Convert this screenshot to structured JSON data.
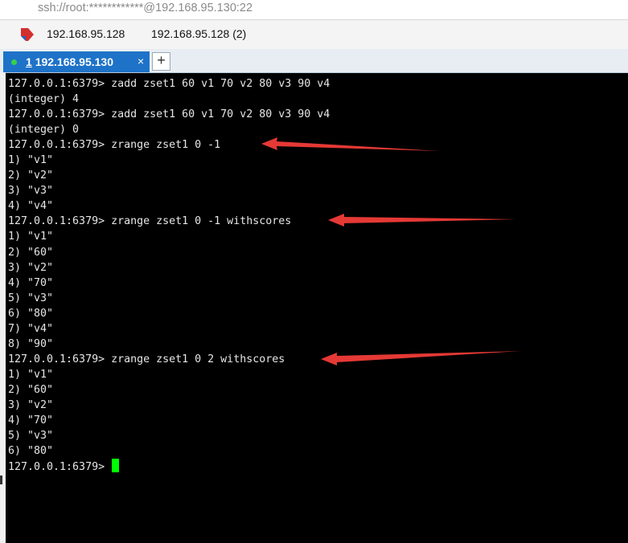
{
  "address_bar": {
    "text": "ssh://root:************@192.168.95.130:22"
  },
  "session_bar": {
    "sessions": [
      "192.168.95.128",
      "192.168.95.128 (2)"
    ]
  },
  "tabs": {
    "active": {
      "number": "1",
      "label": "192.168.95.130",
      "close": "×"
    },
    "add": "+"
  },
  "terminal": {
    "lines": [
      "127.0.0.1:6379> zadd zset1 60 v1 70 v2 80 v3 90 v4",
      "(integer) 4",
      "127.0.0.1:6379> zadd zset1 60 v1 70 v2 80 v3 90 v4",
      "(integer) 0",
      "127.0.0.1:6379> zrange zset1 0 -1",
      "1) \"v1\"",
      "2) \"v2\"",
      "3) \"v3\"",
      "4) \"v4\"",
      "127.0.0.1:6379> zrange zset1 0 -1 withscores",
      "1) \"v1\"",
      "2) \"60\"",
      "3) \"v2\"",
      "4) \"70\"",
      "5) \"v3\"",
      "6) \"80\"",
      "7) \"v4\"",
      "8) \"90\"",
      "127.0.0.1:6379> zrange zset1 0 2 withscores",
      "1) \"v1\"",
      "2) \"60\"",
      "3) \"v2\"",
      "4) \"70\"",
      "5) \"v3\"",
      "6) \"80\""
    ],
    "prompt": "127.0.0.1:6379> "
  },
  "colors": {
    "tab_active": "#1e73c8",
    "terminal_bg": "#000000",
    "terminal_fg": "#e6e6e6",
    "cursor": "#00ff00",
    "arrow": "#e53935"
  },
  "icons": {
    "session": "red-arrow-icon",
    "tab_status": "green-dot-icon"
  }
}
